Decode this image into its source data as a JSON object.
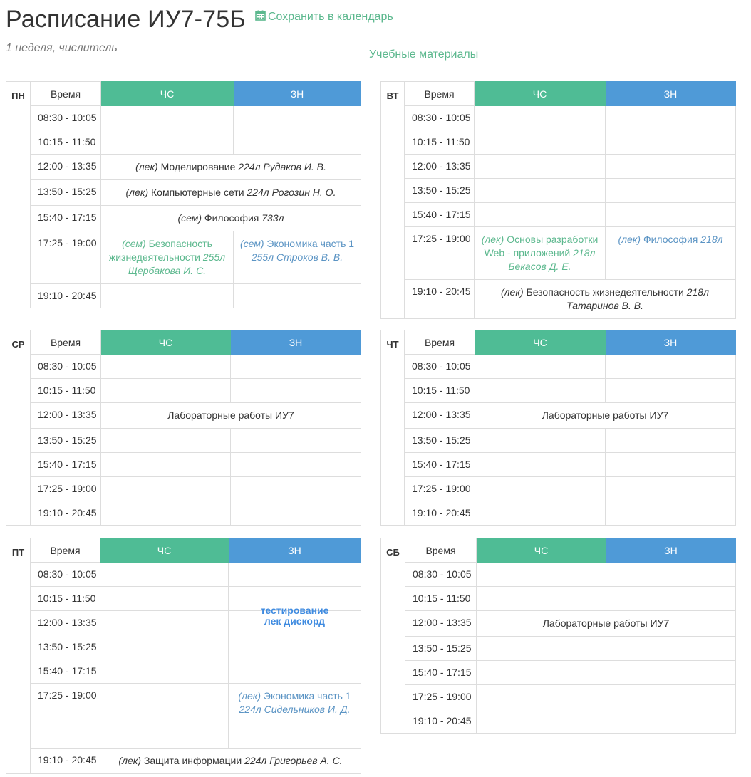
{
  "header": {
    "title": "Расписание ИУ7-75Б",
    "save_label": "Сохранить в календарь",
    "subtitle": "1 неделя, числитель",
    "materials_label": "Учебные материалы"
  },
  "columns": {
    "time": "Время",
    "ch": "ЧС",
    "zn": "ЗН"
  },
  "colors": {
    "ch": "#4fbc95",
    "zn": "#4f9ad7",
    "link": "#5cb88e"
  },
  "days": [
    {
      "name": "ПН",
      "times": [
        "08:30 - 10:05",
        "10:15 - 11:50",
        "12:00 - 13:35",
        "13:50 - 15:25",
        "15:40 - 17:15",
        "17:25 - 19:00",
        "19:10 - 20:45"
      ],
      "lessons": {
        "r2": {
          "type": "(лек)",
          "subject": "Моделирование",
          "room": "224л",
          "teacher": "Рудаков И. В."
        },
        "r3": {
          "type": "(лек)",
          "subject": "Компьютерные сети",
          "room": "224л",
          "teacher": "Рогозин Н. О."
        },
        "r4": {
          "type": "(сем)",
          "subject": "Философия",
          "room": "733л",
          "teacher": ""
        },
        "r5ch": {
          "type": "(сем)",
          "subject": "Безопасность жизнедеятельности",
          "room": "255л",
          "teacher": "Щербакова И. С."
        },
        "r5zn": {
          "type": "(сем)",
          "subject": "Экономика часть 1",
          "room": "255л",
          "teacher": "Строков В. В."
        }
      }
    },
    {
      "name": "ВТ",
      "times": [
        "08:30 - 10:05",
        "10:15 - 11:50",
        "12:00 - 13:35",
        "13:50 - 15:25",
        "15:40 - 17:15",
        "17:25 - 19:00",
        "19:10 - 20:45"
      ],
      "lessons": {
        "r5ch": {
          "type": "(лек)",
          "subject": "Основы разработки Web - приложений",
          "room": "218л",
          "teacher": "Бекасов Д. Е."
        },
        "r5zn": {
          "type": "(лек)",
          "subject": "Философия",
          "room": "218л",
          "teacher": ""
        },
        "r6": {
          "type": "(лек)",
          "subject": "Безопасность жизнедеятельности",
          "room": "218л",
          "teacher": "Татаринов В. В."
        }
      }
    },
    {
      "name": "СР",
      "times": [
        "08:30 - 10:05",
        "10:15 - 11:50",
        "12:00 - 13:35",
        "13:50 - 15:25",
        "15:40 - 17:15",
        "17:25 - 19:00",
        "19:10 - 20:45"
      ],
      "lessons": {
        "r2": {
          "subject": "Лабораторные работы ИУ7"
        }
      }
    },
    {
      "name": "ЧТ",
      "times": [
        "08:30 - 10:05",
        "10:15 - 11:50",
        "12:00 - 13:35",
        "13:50 - 15:25",
        "15:40 - 17:15",
        "17:25 - 19:00",
        "19:10 - 20:45"
      ],
      "lessons": {
        "r2": {
          "subject": "Лабораторные работы ИУ7"
        }
      }
    },
    {
      "name": "ПТ",
      "times": [
        "08:30 - 10:05",
        "10:15 - 11:50",
        "12:00 - 13:35",
        "13:50 - 15:25",
        "15:40 - 17:15",
        "17:25 - 19:00",
        "19:10 - 20:45"
      ],
      "lessons": {
        "note": {
          "line1": "тестирование",
          "line2": "лек дискорд"
        },
        "r5zn": {
          "type": "(лек)",
          "subject": "Экономика часть 1",
          "room": "224л",
          "teacher": "Сидельников И. Д."
        },
        "r6": {
          "type": "(лек)",
          "subject": "Защита информации",
          "room": "224л",
          "teacher": "Григорьев А. С."
        }
      }
    },
    {
      "name": "СБ",
      "times": [
        "08:30 - 10:05",
        "10:15 - 11:50",
        "12:00 - 13:35",
        "13:50 - 15:25",
        "15:40 - 17:15",
        "17:25 - 19:00",
        "19:10 - 20:45"
      ],
      "lessons": {
        "r2": {
          "subject": "Лабораторные работы ИУ7"
        }
      }
    }
  ]
}
